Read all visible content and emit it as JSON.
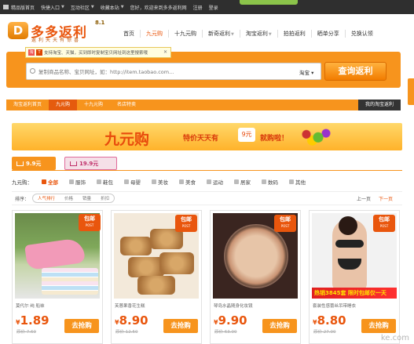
{
  "topbar": {
    "items": [
      "精品版首页",
      "快捷入口",
      "互动社区",
      "收藏本站",
      "您好，欢迎来到多多返利网",
      "注册",
      "登录"
    ]
  },
  "logo": {
    "name": "多多返利",
    "version": "8.1",
    "slogan": "返利天天有惊喜"
  },
  "nav": [
    "首页",
    "九元购",
    "十九元购",
    "新奇返利",
    "淘宝返利",
    "拍拍返利",
    "晒单分享",
    "兑换认领"
  ],
  "tip": {
    "text": "支持淘宝、天猫，买到即时复制宝贝网址到这里搜索哦"
  },
  "search": {
    "placeholder": "复制商品名称、宝贝网址，如：http://item.taobao.com...",
    "type_label": "淘宝",
    "button_label": "查询返利"
  },
  "subnav": {
    "items": [
      "淘宝返利首页",
      "九元购",
      "十九元购",
      "名店特卖"
    ],
    "right_label": "我的淘宝返利"
  },
  "banner": {
    "title": "九元购",
    "slogan": "特价天天有",
    "badge": "9元",
    "tail": "就购啦！"
  },
  "price_tabs": [
    "9.9元",
    "19.9元"
  ],
  "categories": {
    "heading": "九元购：",
    "items": [
      "全部",
      "服饰",
      "鞋包",
      "母婴",
      "美妆",
      "美食",
      "运动",
      "居家",
      "数码",
      "其他"
    ]
  },
  "sort": {
    "label": "排序：",
    "options": [
      "人气排行",
      "价格",
      "销量",
      "折扣"
    ],
    "prev": "上一页",
    "next": "下一页"
  },
  "products": [
    {
      "title": "莫代尔 纯 船袜",
      "price": "1.89",
      "old": "原价 7.60",
      "badge": "包邮",
      "badge_sub": "POST",
      "buy": "去抢购"
    },
    {
      "title": "芙蓉果香花生糕",
      "price": "8.90",
      "old": "原价 12.50",
      "badge": "包邮",
      "badge_sub": "POST",
      "buy": "去抢购"
    },
    {
      "title": "琴岛水晶随身化妆镜",
      "price": "9.90",
      "old": "原价 63.00",
      "badge": "包邮",
      "badge_sub": "POST",
      "buy": "去抢购"
    },
    {
      "title": "套装性感蕾丝吊带睡衣",
      "price": "8.80",
      "old": "原价 27.00",
      "badge": "包邮",
      "badge_sub": "POST",
      "buy": "去抢购",
      "promo": "热销3845套 限时包邮仅一天"
    }
  ],
  "watermark": "ke.com",
  "colors": {
    "accent": "#f7941d",
    "price": "#e9560d",
    "topbar": "#2f2f2f"
  }
}
